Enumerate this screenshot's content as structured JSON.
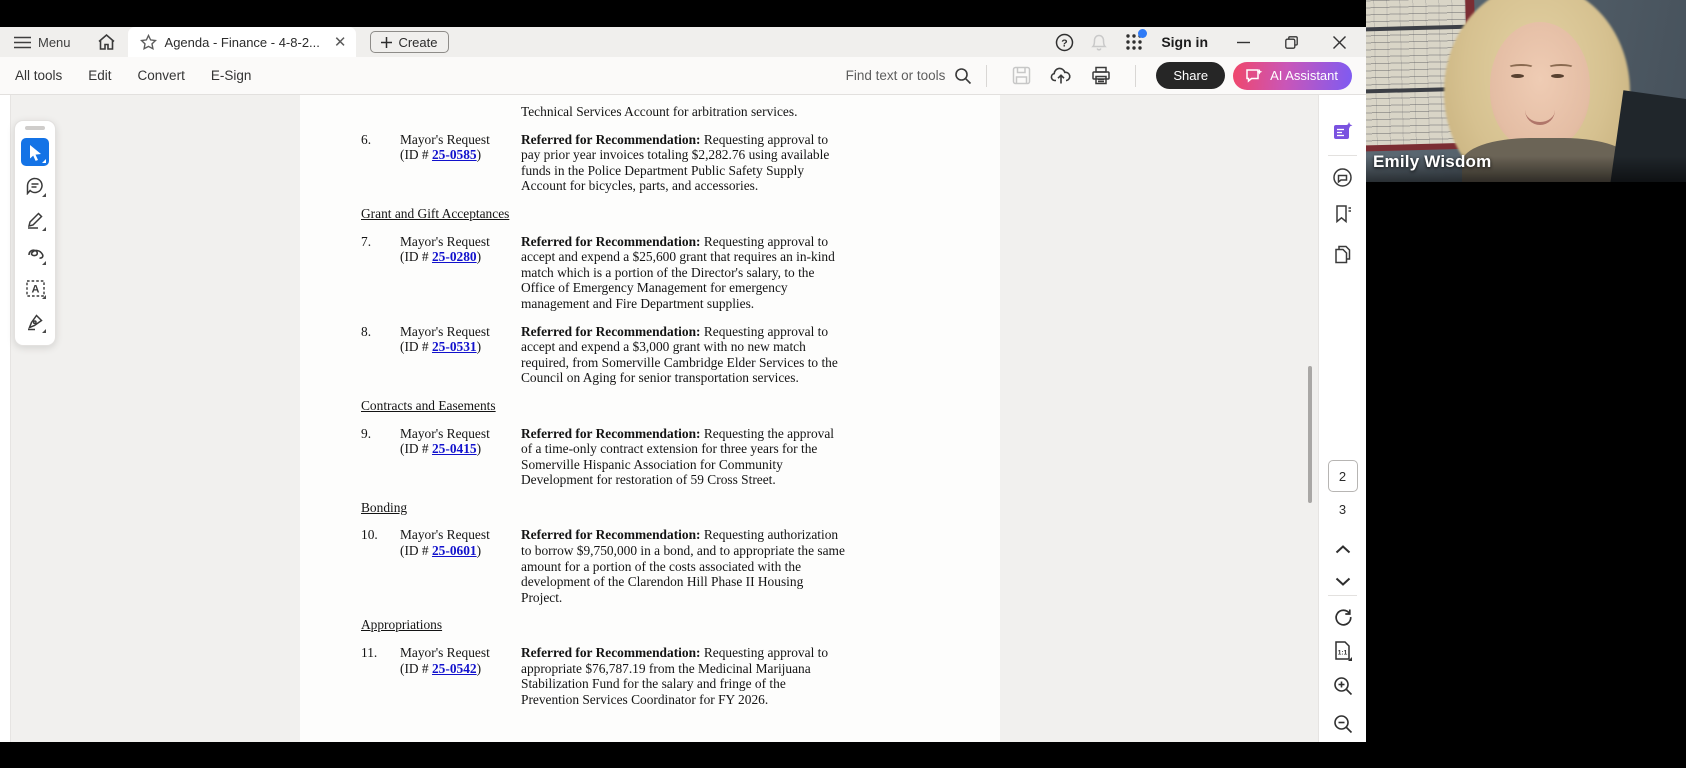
{
  "titlebar": {
    "menu_label": "Menu",
    "tab_title": "Agenda - Finance - 4-8-2...",
    "create_label": "Create",
    "sign_in_label": "Sign in"
  },
  "toolbar": {
    "tabs": [
      "All tools",
      "Edit",
      "Convert",
      "E-Sign"
    ],
    "find_placeholder": "Find text or tools",
    "share_label": "Share",
    "ai_label": "AI Assistant"
  },
  "quick_tools": {
    "tools": [
      {
        "name": "select-tool",
        "icon": "cursor-arrow-icon",
        "selected": true
      },
      {
        "name": "comment-tool",
        "icon": "comment-bubble-icon",
        "selected": false
      },
      {
        "name": "highlight-tool",
        "icon": "highlighter-icon",
        "selected": false
      },
      {
        "name": "draw-tool",
        "icon": "scribble-icon",
        "selected": false
      },
      {
        "name": "add-text-tool",
        "icon": "text-box-icon",
        "selected": false
      },
      {
        "name": "sign-tool",
        "icon": "fountain-pen-icon",
        "selected": false
      }
    ]
  },
  "document": {
    "cont_line": "Technical Services Account for arbitration services.",
    "headings": [
      "Grant and Gift Acceptances",
      "Contracts and Easements",
      "Bonding",
      "Appropriations"
    ],
    "items": [
      {
        "num": "6.",
        "label": "Mayor's Request",
        "id_pre": "(ID # ",
        "id": "25-0585",
        "id_post": ")",
        "bold": "Referred for Recommendation:",
        "desc": "Requesting approval to pay prior year invoices totaling $2,282.76 using available funds in the Police Department Public Safety Supply Account for bicycles, parts, and accessories."
      },
      {
        "num": "7.",
        "label": "Mayor's Request",
        "id_pre": "(ID # ",
        "id": "25-0280",
        "id_post": ")",
        "bold": "Referred for Recommendation:",
        "desc": "Requesting approval to accept and expend a $25,600 grant that requires an in-kind match which is a portion of the Director's salary, to the Office of Emergency Management for emergency management and Fire Department supplies."
      },
      {
        "num": "8.",
        "label": "Mayor's Request",
        "id_pre": "(ID # ",
        "id": "25-0531",
        "id_post": ")",
        "bold": "Referred for Recommendation:",
        "desc": "Requesting approval to accept and expend a $3,000 grant with no new match required, from Somerville Cambridge Elder Services to the Council on Aging for senior transportation services."
      },
      {
        "num": "9.",
        "label": "Mayor's Request",
        "id_pre": "(ID # ",
        "id": "25-0415",
        "id_post": ")",
        "bold": "Referred for Recommendation:",
        "desc": "Requesting the approval of a time-only contract extension for three years for the Somerville Hispanic Association for Community Development for restoration of 59 Cross Street."
      },
      {
        "num": "10.",
        "label": "Mayor's Request",
        "id_pre": "(ID # ",
        "id": "25-0601",
        "id_post": ")",
        "bold": "Referred for Recommendation:",
        "desc": "Requesting authorization to borrow $9,750,000 in a bond, and to appropriate the same amount for a portion of the costs associated with the development of the Clarendon Hill Phase II Housing Project."
      },
      {
        "num": "11.",
        "label": "Mayor's Request",
        "id_pre": "(ID # ",
        "id": "25-0542",
        "id_post": ")",
        "bold": "Referred for Recommendation:",
        "desc": "Requesting approval to appropriate $76,787.19 from the Medicinal Marijuana Stabilization Fund for the salary and fringe of the Prevention Services Coordinator for FY 2026."
      }
    ]
  },
  "right_rail": {
    "current_page": "2",
    "next_page": "3",
    "icons": [
      "ai-summary-icon",
      "comments-icon",
      "bookmarks-icon",
      "page-thumbnails-icon",
      "page-up-icon",
      "page-down-icon",
      "refresh-icon",
      "page-fit-icon",
      "zoom-in-icon",
      "zoom-out-icon"
    ]
  },
  "webcam": {
    "participant_name": "Emily Wisdom"
  },
  "colors": {
    "accent_blue": "#1473e6",
    "link_blue": "#1111cc",
    "share_dark": "#262626",
    "ai_gradient_start": "#f0476b",
    "ai_gradient_end": "#7e5bf2",
    "titlebar_bg": "#f0efed",
    "viewer_bg": "#f1f0ee",
    "webcam_bg": "#515d67"
  }
}
